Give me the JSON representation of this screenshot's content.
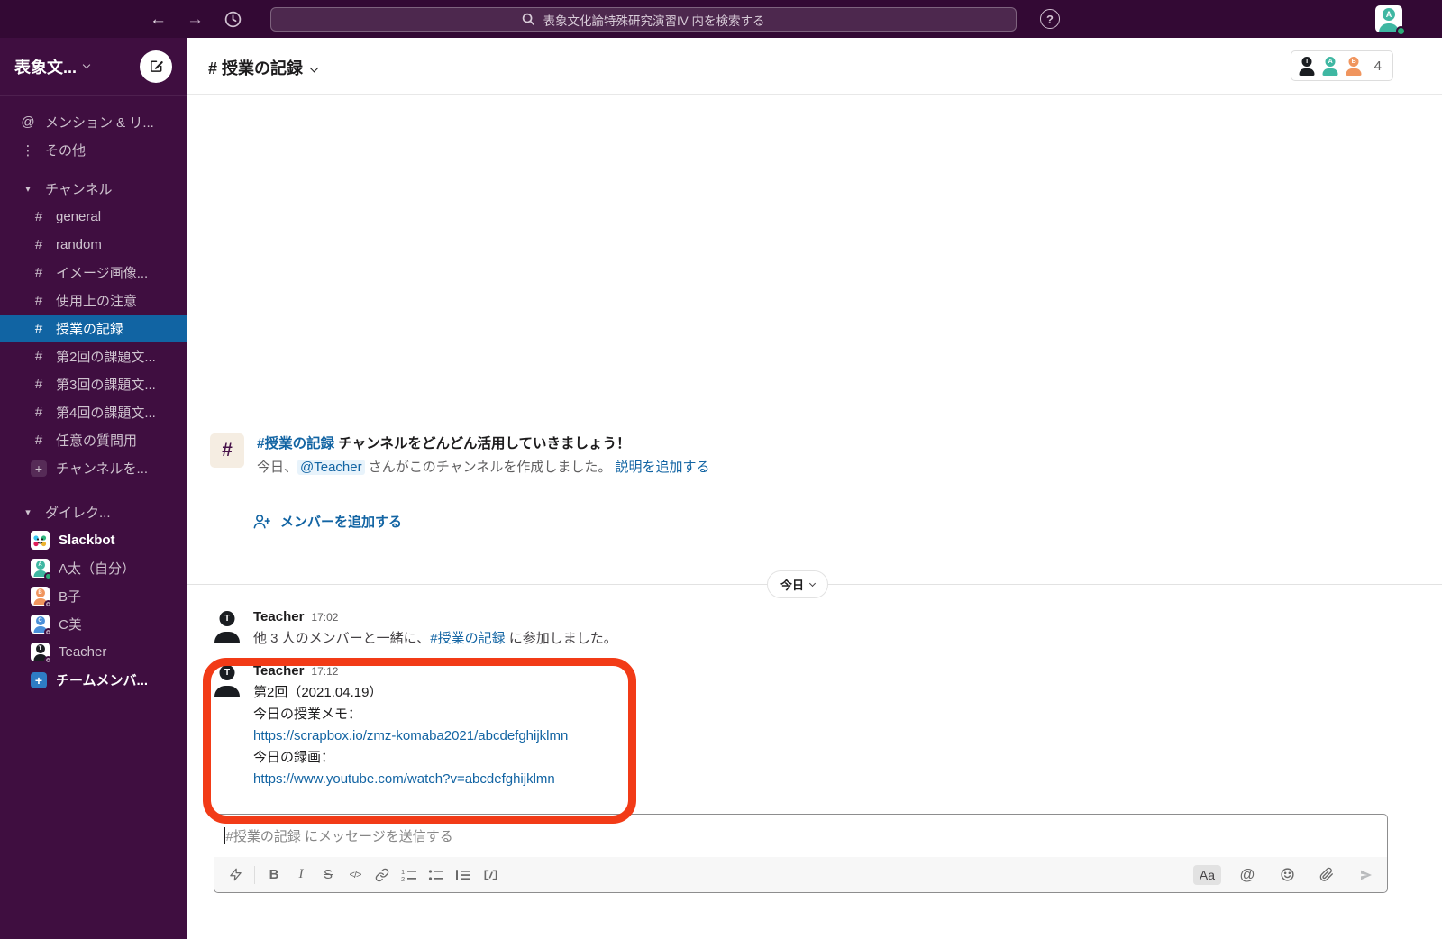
{
  "topbar": {
    "search_text": "表象文化論特殊研究演習IV 内を検索する"
  },
  "letters": {
    "t": "T",
    "a": "A",
    "b": "B",
    "c": "C"
  },
  "sidebar": {
    "workspace_name": "表象文...",
    "mentions_label": "メンション & リ...",
    "more_label": "その他",
    "channels_section": "チャンネル",
    "channels": [
      "general",
      "random",
      "イメージ画像...",
      "使用上の注意",
      "授業の記録",
      "第2回の課題文...",
      "第3回の課題文...",
      "第4回の課題文...",
      "任意の質問用"
    ],
    "add_channel_label": "チャンネルを...",
    "dm_section": "ダイレク...",
    "dm_names": [
      "Slackbot",
      "A太（自分）",
      "B子",
      "C美",
      "Teacher"
    ],
    "invite_label": "チームメンバ..."
  },
  "header": {
    "channel_title": "# 授業の記録",
    "member_count": "4"
  },
  "intro": {
    "channel_link": "#授業の記録",
    "title_rest": " チャンネルをどんどん活用していきましょう！",
    "created_prefix": "今日、",
    "mention": "@Teacher",
    "created_suffix": " さんがこのチャンネルを作成しました。 ",
    "add_description": "説明を追加する",
    "add_members": "メンバーを追加する"
  },
  "timeline": {
    "date_divider": "今日",
    "msg1": {
      "sender": "Teacher",
      "time": "17:02",
      "join_prefix": "他 3 人のメンバーと一緒に、",
      "channel_ref": "#授業の記録",
      "join_suffix": " に参加しました。"
    },
    "msg2": {
      "sender": "Teacher",
      "time": "17:12",
      "line1": "第2回（2021.04.19）",
      "line2": "今日の授業メモ：",
      "link1": "https://scrapbox.io/zmz-komaba2021/abcdefghijklmn",
      "line3": "今日の録画：",
      "link2": "https://www.youtube.com/watch?v=abcdefghijklmn"
    }
  },
  "composer": {
    "placeholder": "#授業の記録 にメッセージを送信する",
    "format_button": "Aa"
  },
  "colors": {
    "topbar": "#330934",
    "sidebar": "#3f0e40",
    "active_item": "#1164a3",
    "link": "#1264a3",
    "annotation": "#f23b17",
    "teal": "#3fb7a2",
    "orange": "#f0955e",
    "blue": "#4a90d9",
    "black_avatar": "#1a1d21"
  }
}
